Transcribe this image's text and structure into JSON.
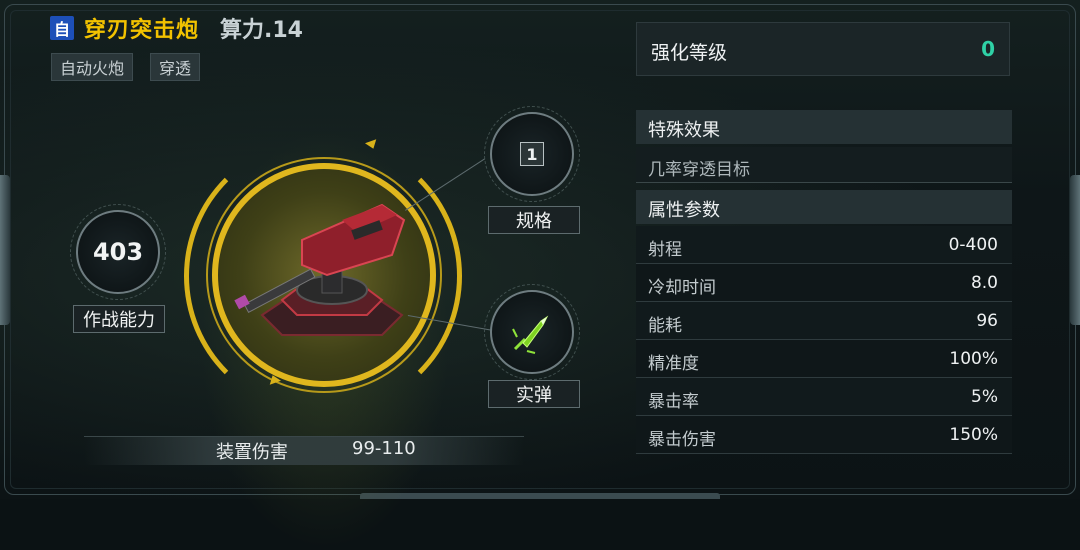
{
  "header": {
    "auto_badge": "自",
    "weapon_name": "穿刃突击炮",
    "power": "算力.14",
    "tags": [
      "自动火炮",
      "穿透"
    ]
  },
  "stats": {
    "combat_power_value": "403",
    "combat_power_label": "作战能力",
    "spec_value": "1",
    "spec_label": "规格",
    "ammo_label": "实弹",
    "device_damage_label": "装置伤害",
    "device_damage_value": "99-110"
  },
  "enhance": {
    "label": "强化等级",
    "value": "0"
  },
  "special": {
    "title": "特殊效果",
    "effect": "几率穿透目标"
  },
  "attributes": {
    "title": "属性参数",
    "rows": [
      {
        "name": "射程",
        "value": "0-400"
      },
      {
        "name": "冷却时间",
        "value": "8.0"
      },
      {
        "name": "能耗",
        "value": "96"
      },
      {
        "name": "精准度",
        "value": "100%"
      },
      {
        "name": "暴击率",
        "value": "5%"
      },
      {
        "name": "暴击伤害",
        "value": "150%"
      }
    ]
  },
  "colors": {
    "weapon_name": "#f2c200",
    "enhance_value": "#2fd1a6",
    "ring": "#e0b71e",
    "badge": "#1d4fb8"
  },
  "icons": [
    "turret-image",
    "ammo-bullet-icon"
  ]
}
